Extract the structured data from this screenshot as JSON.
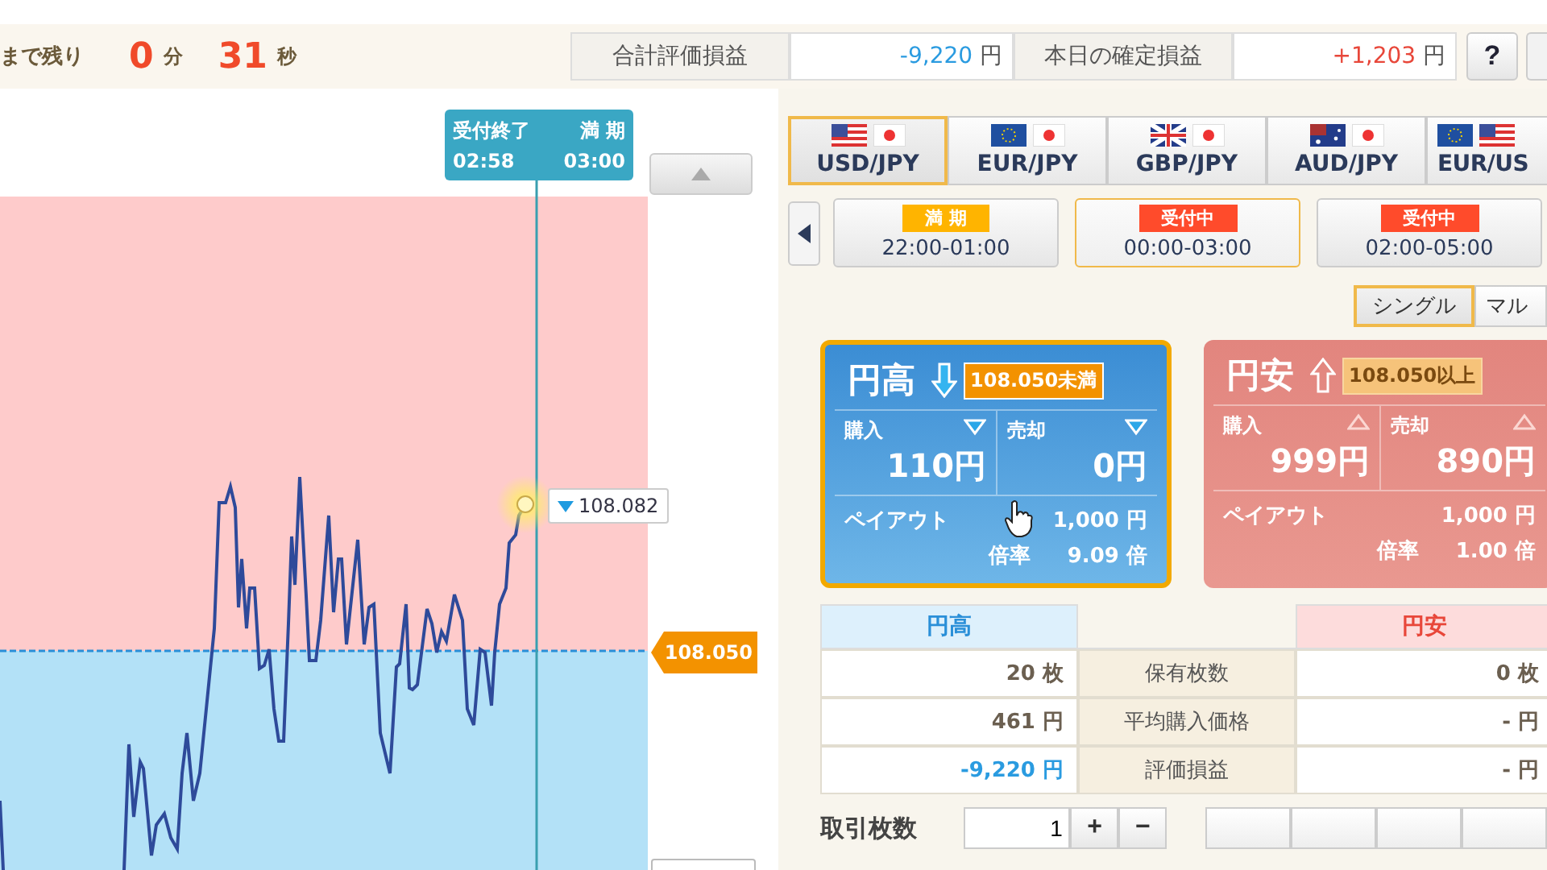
{
  "countdown": {
    "label": "まで残り",
    "minutes": "0",
    "minutes_unit": "分",
    "seconds": "31",
    "seconds_unit": "秒"
  },
  "summary": [
    {
      "label": "合計評価損益",
      "value": "-9,220",
      "unit": "円",
      "negative": true
    },
    {
      "label": "本日の確定損益",
      "value": "+1,203",
      "unit": "円",
      "negative": false
    }
  ],
  "help_button": "?",
  "chart": {
    "deadline_label": "受付終了",
    "deadline_time": "02:58",
    "expiry_label": "満 期",
    "expiry_time": "03:00",
    "current_price": "108.082",
    "strike": "108.050"
  },
  "pairs": [
    {
      "label": "USD/JPY",
      "selected": true
    },
    {
      "label": "EUR/JPY",
      "selected": false
    },
    {
      "label": "GBP/JPY",
      "selected": false
    },
    {
      "label": "AUD/JPY",
      "selected": false
    },
    {
      "label": "EUR/US",
      "selected": false
    }
  ],
  "sessions": [
    {
      "status": "満 期",
      "expired": true,
      "time": "22:00-01:00",
      "selected": false
    },
    {
      "status": "受付中",
      "expired": false,
      "time": "00:00-03:00",
      "selected": true
    },
    {
      "status": "受付中",
      "expired": false,
      "time": "02:00-05:00",
      "selected": false
    }
  ],
  "modes": [
    {
      "label": "シングル",
      "selected": true
    },
    {
      "label": "マル",
      "selected": false
    }
  ],
  "options": [
    {
      "kind": "down",
      "title": "円高",
      "condition": "108.050未満",
      "buy_label": "購入",
      "buy": "110円",
      "sell_label": "売却",
      "sell": "0円",
      "payout_label": "ペイアウト",
      "payout": "1,000 円",
      "rate_label": "倍率",
      "rate": "9.09 倍",
      "selected": true,
      "disabled": false
    },
    {
      "kind": "up",
      "title": "円安",
      "condition": "108.050以上",
      "buy_label": "購入",
      "buy": "999円",
      "sell_label": "売却",
      "sell": "890円",
      "payout_label": "ペイアウト",
      "payout": "1,000 円",
      "rate_label": "倍率",
      "rate": "1.00 倍",
      "selected": false,
      "disabled": true
    }
  ],
  "positions": {
    "high_header": "円高",
    "low_header": "円安",
    "rows": [
      {
        "label": "保有枚数",
        "high": "20 枚",
        "low": "0 枚",
        "negative": false
      },
      {
        "label": "平均購入価格",
        "high": "461 円",
        "low": "- 円",
        "negative": false
      },
      {
        "label": "評価損益",
        "high": "-9,220 円",
        "low": "- 円",
        "negative": true
      }
    ]
  },
  "order": {
    "label": "取引枚数",
    "quantity": "1",
    "plus": "+",
    "minus": "−"
  }
}
